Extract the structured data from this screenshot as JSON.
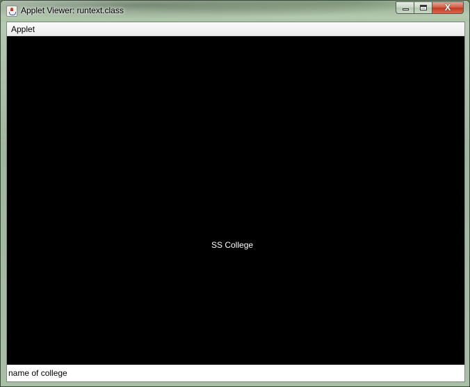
{
  "window": {
    "title": "Applet Viewer: runtext.class",
    "icon": "java-icon",
    "controls": {
      "minimize": "minimize-icon",
      "maximize": "maximize-icon",
      "close": "close-icon",
      "close_glyph": "X"
    }
  },
  "menubar": {
    "items": [
      {
        "label": "Applet"
      }
    ]
  },
  "applet": {
    "background": "#000000",
    "text_color": "#ffffff",
    "text": "SS College"
  },
  "status": {
    "text": "name of college"
  }
}
